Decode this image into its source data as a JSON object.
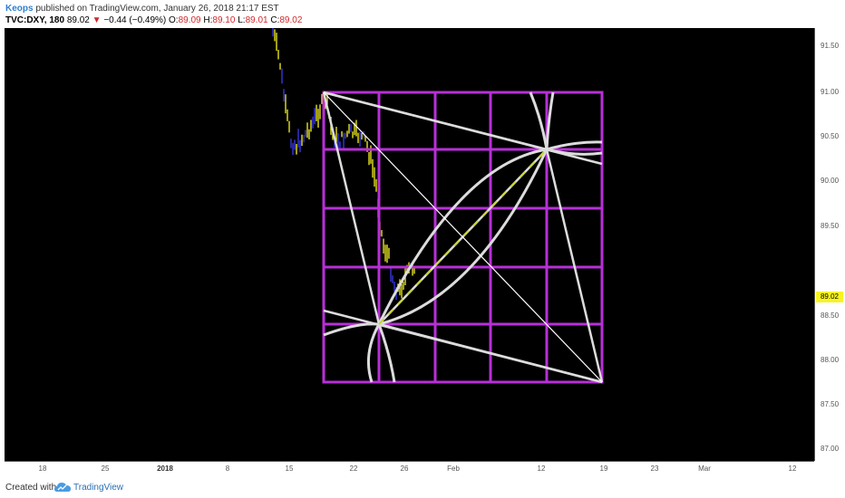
{
  "header": {
    "author": "Keops",
    "published_text": "published on TradingView.com, January 26, 2018 21:17 EST",
    "symbol": "TVC:DXY, 180",
    "last_price": "89.02",
    "change_arrow": "▼",
    "change": "−0.44 (−0.49%)",
    "open_label": "O:",
    "open_value": "89.09",
    "high_label": "H:",
    "high_value": "89.10",
    "low_label": "L:",
    "low_value": "89.01",
    "close_label": "C:",
    "close_value": "89.02"
  },
  "price_axis": {
    "ticks": [
      "91.50",
      "91.00",
      "90.50",
      "90.00",
      "89.50",
      "89.02",
      "88.50",
      "88.00",
      "87.50",
      "87.00"
    ],
    "current_price": "89.02"
  },
  "time_axis": {
    "ticks": [
      "18",
      "25",
      "2018",
      "8",
      "15",
      "22",
      "26",
      "Feb",
      "12",
      "19",
      "23",
      "Mar",
      "12"
    ],
    "bold_tick": "2018"
  },
  "footer": {
    "created_with": "Created with",
    "brand": "TradingView",
    "logo_icon": "tradingview-cloud-icon"
  },
  "colors": {
    "background": "#000000",
    "bar_up": "#f7f421",
    "bar_down": "#3a3af0",
    "grid_square": "#b82fd8",
    "arcs": "#dcdcdc",
    "dashed_line": "#c9d62a",
    "current_price_label": "#f7f421"
  },
  "chart_data": {
    "type": "candlestick",
    "symbol": "TVC:DXY",
    "interval": "180",
    "y_range": [
      86.9,
      91.8
    ],
    "price_ticks": [
      91.5,
      91.0,
      90.5,
      90.0,
      89.5,
      88.5,
      88.0,
      87.5,
      87.0
    ],
    "last_price": 89.02,
    "ohlc_last": {
      "open": 89.09,
      "high": 89.1,
      "low": 89.01,
      "close": 89.02
    },
    "gann_square": {
      "top_price": 91.0,
      "bottom_price": 87.72,
      "grid_divisions": 5
    }
  }
}
